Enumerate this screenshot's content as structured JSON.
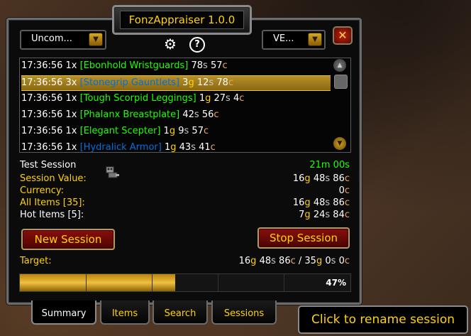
{
  "title": "FonzAppraiser 1.0.0",
  "dropdowns": {
    "quality": {
      "label": "Uncom..."
    },
    "view": {
      "label": "VE..."
    }
  },
  "icons": {
    "close": "close-icon",
    "settings": "gear-icon",
    "help": "help-icon",
    "dropdown_arrow": "chevron-down-icon",
    "scroll_up": "scroll-up-icon",
    "scroll_down": "scroll-down-icon",
    "session_robot": "robot-icon"
  },
  "help_glyph": "?",
  "close_glyph": "✕",
  "items": [
    {
      "time": "17:36:56",
      "qty": "1x",
      "name": "[Ebonhold Wristguards]",
      "quality": "uncommon",
      "value": [
        {
          "n": "78",
          "u": "s"
        },
        {
          "n": "57",
          "u": "c"
        }
      ],
      "selected": false
    },
    {
      "time": "17:36:56",
      "qty": "3x",
      "name": "[Stonegrip Gauntlets]",
      "quality": "rare",
      "value": [
        {
          "n": "3",
          "u": "g"
        },
        {
          "n": "12",
          "u": "s"
        },
        {
          "n": "78",
          "u": "c"
        }
      ],
      "selected": true
    },
    {
      "time": "17:36:56",
      "qty": "1x",
      "name": "[Tough Scorpid Leggings]",
      "quality": "uncommon",
      "value": [
        {
          "n": "1",
          "u": "g"
        },
        {
          "n": "27",
          "u": "s"
        },
        {
          "n": "4",
          "u": "c"
        }
      ],
      "selected": false
    },
    {
      "time": "17:36:56",
      "qty": "1x",
      "name": "[Phalanx Breastplate]",
      "quality": "uncommon",
      "value": [
        {
          "n": "42",
          "u": "s"
        },
        {
          "n": "56",
          "u": "c"
        }
      ],
      "selected": false
    },
    {
      "time": "17:36:56",
      "qty": "1x",
      "name": "[Elegant Scepter]",
      "quality": "uncommon",
      "value": [
        {
          "n": "1",
          "u": "g"
        },
        {
          "n": "9",
          "u": "s"
        },
        {
          "n": "57",
          "u": "c"
        }
      ],
      "selected": false
    },
    {
      "time": "17:36:56",
      "qty": "1x",
      "name": "[Hydralick Armor]",
      "quality": "rare",
      "value": [
        {
          "n": "1",
          "u": "g"
        },
        {
          "n": "43",
          "u": "s"
        },
        {
          "n": "41",
          "u": "c"
        }
      ],
      "selected": false
    }
  ],
  "session": {
    "name": "Test Session",
    "duration": "21m 00s",
    "stats": [
      {
        "label": "Session Value:",
        "color": "yellow",
        "value": [
          {
            "n": "16",
            "u": "g"
          },
          {
            "n": "48",
            "u": "s"
          },
          {
            "n": "86",
            "u": "c"
          }
        ]
      },
      {
        "label": "Currency:",
        "color": "yellow",
        "value": [
          {
            "n": "0",
            "u": "c"
          }
        ]
      },
      {
        "label": "All Items [35]:",
        "color": "yellow",
        "value": [
          {
            "n": "16",
            "u": "g"
          },
          {
            "n": "48",
            "u": "s"
          },
          {
            "n": "86",
            "u": "c"
          }
        ]
      },
      {
        "label": "Hot Items [5]:",
        "color": "white",
        "value": [
          {
            "n": "7",
            "u": "g"
          },
          {
            "n": "24",
            "u": "s"
          },
          {
            "n": "84",
            "u": "c"
          }
        ]
      }
    ]
  },
  "buttons": {
    "new_session": "New Session",
    "stop_session": "Stop Session"
  },
  "target": {
    "label": "Target:",
    "current": [
      {
        "n": "16",
        "u": "g"
      },
      {
        "n": "48",
        "u": "s"
      },
      {
        "n": "86",
        "u": "c"
      }
    ],
    "separator": " / ",
    "goal": [
      {
        "n": "35",
        "u": "g"
      },
      {
        "n": "0",
        "u": "s"
      },
      {
        "n": "0",
        "u": "c"
      }
    ],
    "progress_percent": 47,
    "progress_text": "47%"
  },
  "tabs": [
    {
      "label": "Summary",
      "active": true
    },
    {
      "label": "Items",
      "active": false
    },
    {
      "label": "Search",
      "active": false
    },
    {
      "label": "Sessions",
      "active": false
    }
  ],
  "rename_hint": "Click to rename session",
  "colors": {
    "uncommon": "#1eff00",
    "rare": "#0070dd",
    "gold": "#ffd200",
    "silver": "#c7c7cf",
    "copper": "#eda55f"
  }
}
